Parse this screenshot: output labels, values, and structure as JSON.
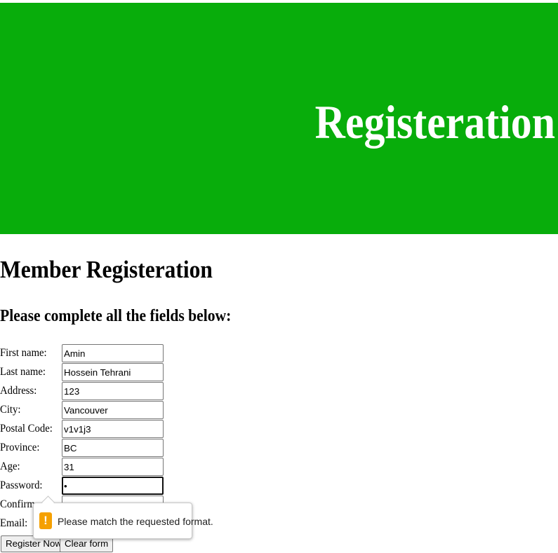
{
  "banner": {
    "title": "Registeration",
    "color": "#08ad0b"
  },
  "heading": "Member Registeration",
  "subheading": "Please complete all the fields below:",
  "form": {
    "first_name": {
      "label": "First name:",
      "value": "Amin"
    },
    "last_name": {
      "label": "Last name:",
      "value": "Hossein Tehrani"
    },
    "address": {
      "label": "Address:",
      "value": "123"
    },
    "city": {
      "label": "City:",
      "value": "Vancouver"
    },
    "postal_code": {
      "label": "Postal Code:",
      "value": "v1v1j3"
    },
    "province": {
      "label": "Province:",
      "value": "BC"
    },
    "age": {
      "label": "Age:",
      "value": "31"
    },
    "password": {
      "label": "Password:",
      "value": "•"
    },
    "confirm": {
      "label": "Confirm",
      "value": ""
    },
    "email": {
      "label": "Email:",
      "value": ""
    }
  },
  "buttons": {
    "register": "Register Now",
    "clear": "Clear form"
  },
  "validation": {
    "message": "Please match the requested format.",
    "icon": "warning-icon",
    "icon_glyph": "!",
    "icon_color": "#f5a000"
  }
}
